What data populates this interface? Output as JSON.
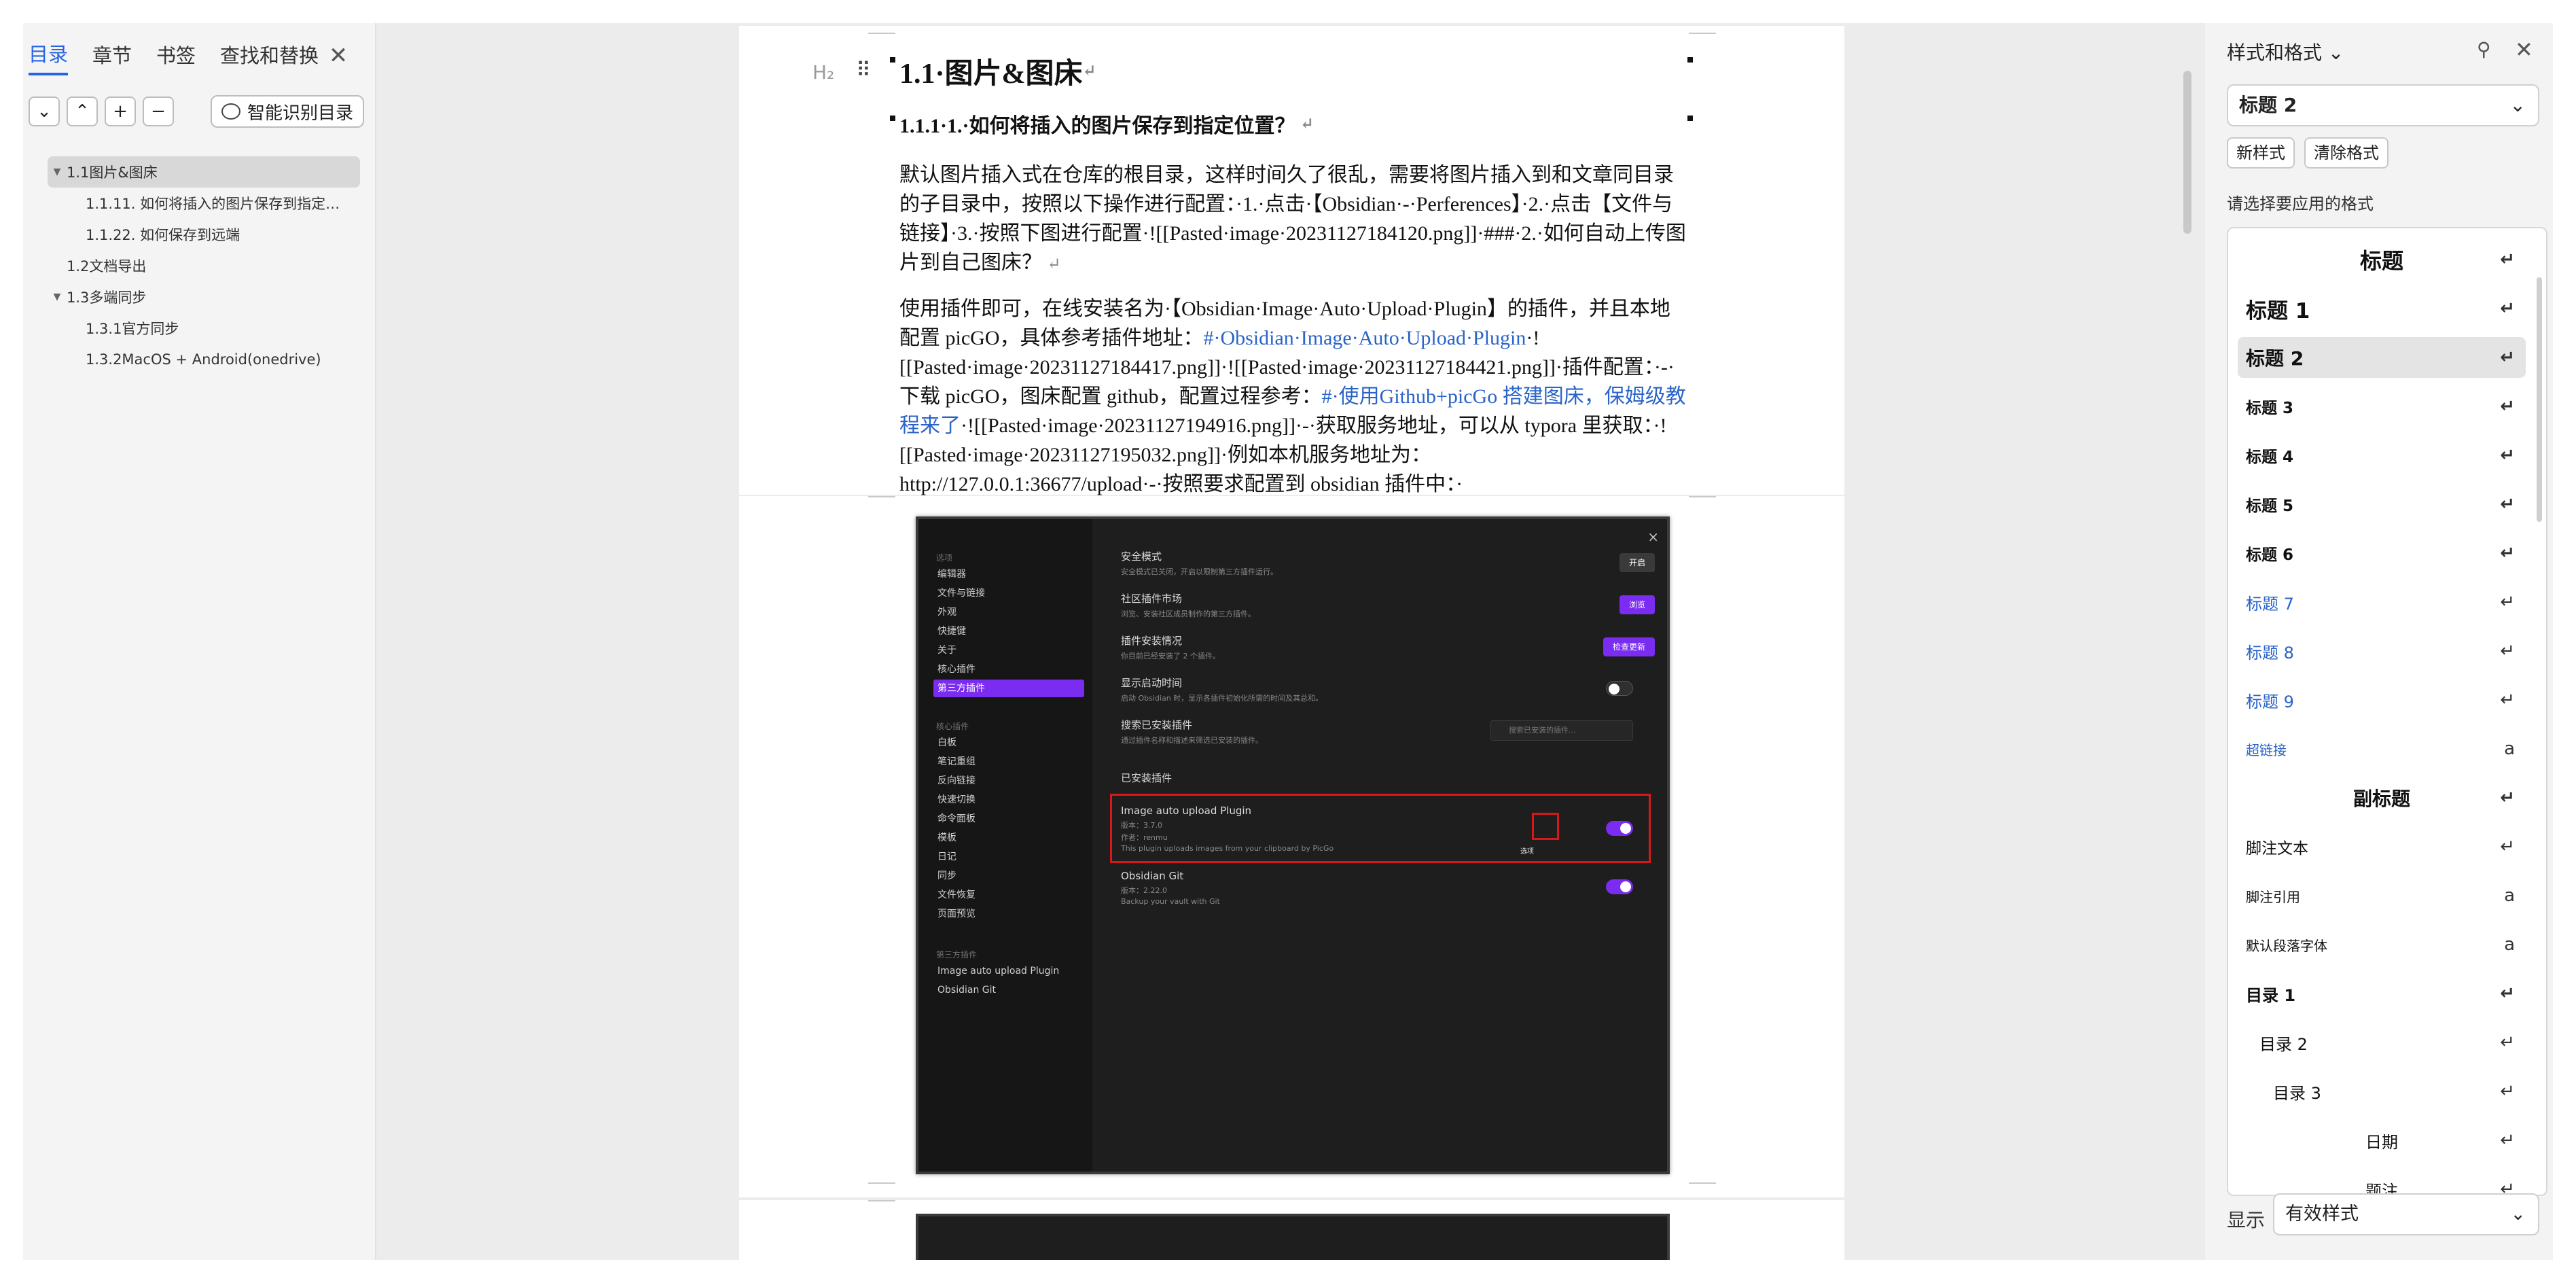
{
  "nav": {
    "tabs": [
      "目录",
      "章节",
      "书签",
      "查找和替换"
    ],
    "close": "✕",
    "smart_toc": "智能识别目录",
    "items": [
      {
        "label": "1.1图片&图床",
        "level": 1,
        "expanded": true,
        "selected": true
      },
      {
        "label": "1.1.11. 如何将插入的图片保存到指定…",
        "level": 2
      },
      {
        "label": "1.1.22. 如何保存到远端",
        "level": 2
      },
      {
        "label": "1.2文档导出",
        "level": 1
      },
      {
        "label": "1.3多端同步",
        "level": 1,
        "expanded": true
      },
      {
        "label": "1.3.1官方同步",
        "level": 2
      },
      {
        "label": "1.3.2MacOS + Android(onedrive)",
        "level": 2
      }
    ]
  },
  "doc": {
    "h_marker": "H₂",
    "h1": "1.1·图片&图床",
    "h2": "1.1.1·1.·如何将插入的图片保存到指定位置？",
    "para1": "默认图片插入式在仓库的根目录，这样时间久了很乱，需要将图片插入到和文章同目录的子目录中，按照以下操作进行配置：·1.·点击·【Obsidian·-·Perferences】·2.·点击【文件与链接】·3.·按照下图进行配置·![[Pasted·image·20231127184120.png]]·###·2.·如何自动上传图片到自己图床？",
    "para2_a": "使用插件即可，在线安装名为·【Obsidian·Image·Auto·Upload·Plugin】的插件，并且本地配置 picGO，具体参考插件地址：",
    "para2_link1": "#·Obsidian·Image·Auto·Upload·Plugin",
    "para2_b": "·![[Pasted·image·20231127184417.png]]·![[Pasted·image·20231127184421.png]]·插件配置：·-·下载 picGO，图床配置 github，配置过程参考：",
    "para2_link2": "#·使用Github+picGo 搭建图床，保姆级教程来了",
    "para2_c": "·![[Pasted·image·20231127194916.png]]·-·获取服务地址，可以从 typora 里获取：·![[Pasted·image·20231127195032.png]]·例如本机服务地址为：http://127.0.0.1:36677/upload·-·按照要求配置到 obsidian 插件中：·",
    "return_mark": "↵"
  },
  "obsidian": {
    "sidebar_group1": "选项",
    "sidebar": [
      "编辑器",
      "文件与链接",
      "外观",
      "快捷键",
      "关于",
      "核心插件",
      "第三方插件"
    ],
    "sidebar_group2": "核心插件",
    "core": [
      "白板",
      "笔记重组",
      "反向链接",
      "快速切换",
      "命令面板",
      "模板",
      "日记",
      "同步",
      "文件恢复",
      "页面预览"
    ],
    "sidebar_group3": "第三方插件",
    "thirdparty": [
      "Image auto upload Plugin",
      "Obsidian Git"
    ],
    "close": "×",
    "rows": [
      {
        "title": "安全模式",
        "sub": "安全模式已关闭，开启以限制第三方插件运行。",
        "btn": "开启"
      },
      {
        "title": "社区插件市场",
        "sub": "浏览、安装社区成员制作的第三方插件。",
        "btn": "浏览"
      },
      {
        "title": "插件安装情况",
        "sub": "你目前已经安装了 2 个插件。",
        "btn": "检查更新"
      },
      {
        "title": "显示启动时间",
        "sub": "启动 Obsidian 时，显示各插件初始化所需的时间及其总和。"
      },
      {
        "title": "搜索已安装插件",
        "sub": "通过插件名称和描述来筛选已安装的插件。",
        "search": "搜索已安装的插件..."
      }
    ],
    "installed_header": "已安装插件",
    "plugin1": {
      "name": "Image auto upload Plugin",
      "version": "版本：3.7.0",
      "author": "作者：renmu",
      "desc": "This plugin uploads images from your clipboard by PicGo",
      "tip": "选项"
    },
    "plugin2": {
      "name": "Obsidian Git",
      "version": "版本：2.22.0",
      "desc": "Backup your vault with Git"
    }
  },
  "right": {
    "title": "样式和格式",
    "current": "标题 2",
    "new_style": "新样式",
    "clear_format": "清除格式",
    "prompt": "请选择要应用的格式",
    "styles": [
      {
        "label": "标题",
        "kind": "center-bold-lg",
        "mark": "↵"
      },
      {
        "label": "标题 1",
        "kind": "bold-xl",
        "mark": "↵"
      },
      {
        "label": "标题 2",
        "kind": "bold-lg",
        "mark": "↵",
        "selected": true
      },
      {
        "label": "标题 3",
        "kind": "bold-sm",
        "mark": "↵"
      },
      {
        "label": "标题 4",
        "kind": "bold-sm",
        "mark": "↵"
      },
      {
        "label": "标题 5",
        "kind": "bold-sm",
        "mark": "↵"
      },
      {
        "label": "标题 6",
        "kind": "bold-sm",
        "mark": "↵"
      },
      {
        "label": "标题 7",
        "kind": "blue",
        "mark": "↵"
      },
      {
        "label": "标题 8",
        "kind": "blue",
        "mark": "↵"
      },
      {
        "label": "标题 9",
        "kind": "blue",
        "mark": "↵"
      },
      {
        "label": "超链接",
        "kind": "blue-sm",
        "mark": "a"
      },
      {
        "label": "副标题",
        "kind": "center-bold",
        "mark": "↵"
      },
      {
        "label": "脚注文本",
        "kind": "normal",
        "mark": "↵"
      },
      {
        "label": "脚注引用",
        "kind": "small",
        "mark": "a"
      },
      {
        "label": "默认段落字体",
        "kind": "small",
        "mark": "a"
      },
      {
        "label": "目录 1",
        "kind": "bold-md",
        "mark": "↵"
      },
      {
        "label": "目录 2",
        "kind": "indent1",
        "mark": "↵"
      },
      {
        "label": "目录 3",
        "kind": "indent2",
        "mark": "↵"
      },
      {
        "label": "日期",
        "kind": "center",
        "mark": "↵"
      },
      {
        "label": "题注",
        "kind": "center-cut",
        "mark": "↵"
      }
    ],
    "display_label": "显示",
    "display_value": "有效样式"
  }
}
